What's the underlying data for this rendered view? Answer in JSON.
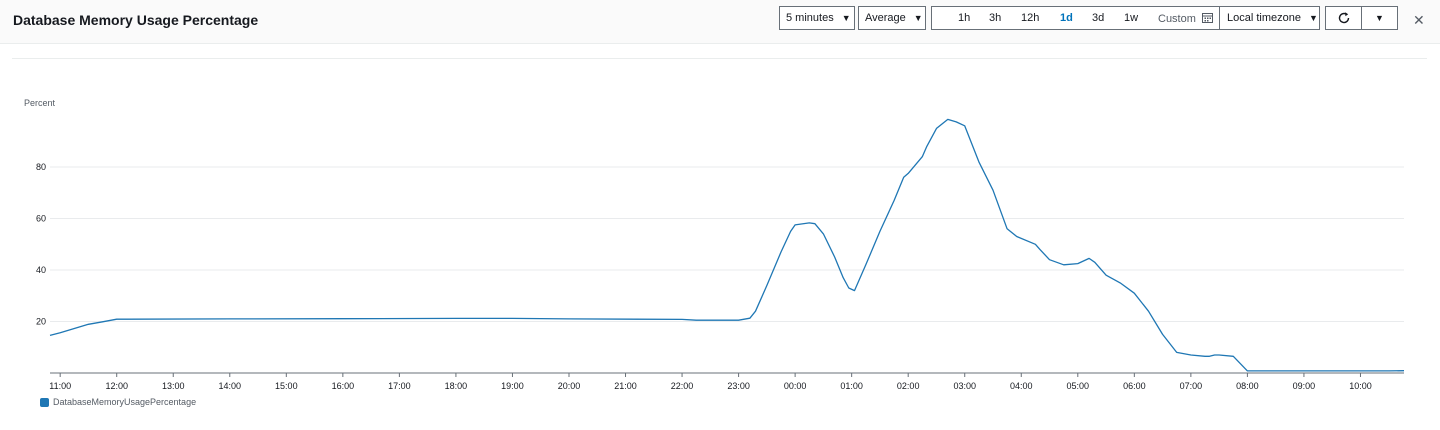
{
  "header": {
    "title": "Database Memory Usage Percentage",
    "period": "5 minutes",
    "statistic": "Average",
    "ranges": [
      "1h",
      "3h",
      "12h",
      "1d",
      "3d",
      "1w"
    ],
    "active_range": "1d",
    "custom_label": "Custom",
    "timezone": "Local timezone"
  },
  "icons": {
    "period_caret": "caret-down-icon",
    "stat_caret": "caret-down-icon",
    "calendar": "calendar-icon",
    "tz_caret": "caret-down-icon",
    "refresh": "refresh-icon",
    "menu": "caret-down-icon",
    "close": "close-icon"
  },
  "colors": {
    "line": "#1f77b4",
    "grid": "#e9ebed",
    "axis": "#545b64",
    "accent": "#0073bb"
  },
  "chart_data": {
    "type": "line",
    "title": "",
    "ylabel": "Percent",
    "xlabel": "",
    "ylim": [
      0,
      100
    ],
    "yticks": [
      20,
      40,
      60,
      80
    ],
    "grid": true,
    "legend_position": "bottom-left",
    "x_tick_labels": [
      "11:00",
      "12:00",
      "13:00",
      "14:00",
      "15:00",
      "16:00",
      "17:00",
      "18:00",
      "19:00",
      "20:00",
      "21:00",
      "22:00",
      "23:00",
      "00:00",
      "01:00",
      "02:00",
      "03:00",
      "04:00",
      "05:00",
      "06:00",
      "07:00",
      "08:00",
      "09:00",
      "10:00"
    ],
    "x_range": [
      10.82,
      34.77
    ],
    "series": [
      {
        "name": "DatabaseMemoryUsagePercentage",
        "color": "#1f77b4",
        "x": [
          10.82,
          11.0,
          11.25,
          11.5,
          11.75,
          12.0,
          14.0,
          16.0,
          18.0,
          19.0,
          20.0,
          22.0,
          22.25,
          23.0,
          23.2,
          23.3,
          23.5,
          23.75,
          23.92,
          24.0,
          24.25,
          24.35,
          24.5,
          24.7,
          24.85,
          24.95,
          25.05,
          25.25,
          25.5,
          25.75,
          25.92,
          26.0,
          26.25,
          26.33,
          26.5,
          26.7,
          26.85,
          27.0,
          27.25,
          27.5,
          27.75,
          27.92,
          28.25,
          28.33,
          28.5,
          28.75,
          29.0,
          29.2,
          29.3,
          29.5,
          29.75,
          30.0,
          30.25,
          30.5,
          30.75,
          31.0,
          31.25,
          31.33,
          31.42,
          31.5,
          31.75,
          32.0,
          34.0,
          34.5,
          34.77
        ],
        "y": [
          14.6,
          15.6,
          17.3,
          18.9,
          19.9,
          20.9,
          21.0,
          21.1,
          21.2,
          21.2,
          21.0,
          20.8,
          20.5,
          20.5,
          21.3,
          24.0,
          34.0,
          47.0,
          55.0,
          57.5,
          58.3,
          58.0,
          54.0,
          45.0,
          37.0,
          33.0,
          32.0,
          42.0,
          55.0,
          67.0,
          76.0,
          77.5,
          84.0,
          88.0,
          95.0,
          98.5,
          97.5,
          96.0,
          82.0,
          71.0,
          56.0,
          53.0,
          50.0,
          48.0,
          44.0,
          42.0,
          42.5,
          44.5,
          43.0,
          38.0,
          35.0,
          31.0,
          24.0,
          15.0,
          8.0,
          7.0,
          6.5,
          6.5,
          7.0,
          7.0,
          6.5,
          0.8,
          0.8,
          0.8,
          0.9
        ]
      }
    ]
  }
}
